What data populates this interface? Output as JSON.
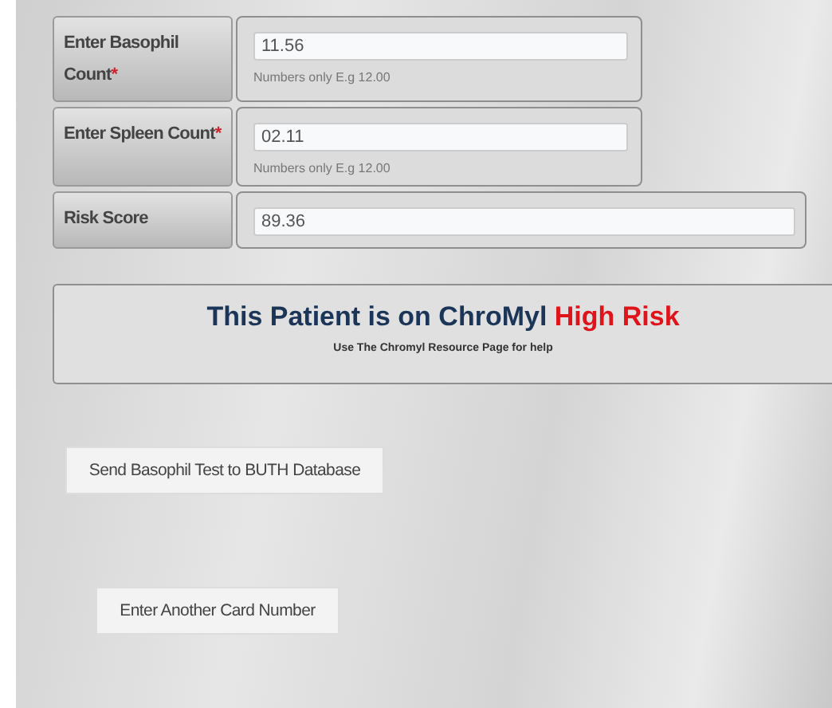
{
  "fields": [
    {
      "label": "Enter Basophil Count",
      "required_mark": "*",
      "value": "11.56",
      "hint": "Numbers only E.g 12.00"
    },
    {
      "label": "Enter Spleen Count",
      "required_mark": "*",
      "value": "02.11",
      "hint": "Numbers only E.g 12.00"
    },
    {
      "label": "Risk Score",
      "value": "89.36"
    }
  ],
  "result": {
    "title": "This Patient is on ChroMyl",
    "risk": {
      "label": "High Risk",
      "kind": "high"
    },
    "help": "Use The Chromyl Resource Page for help"
  },
  "buttons": [
    {
      "label": "Send Basophil Test to BUTH Database"
    },
    {
      "label": "Enter Another Card Number"
    }
  ]
}
